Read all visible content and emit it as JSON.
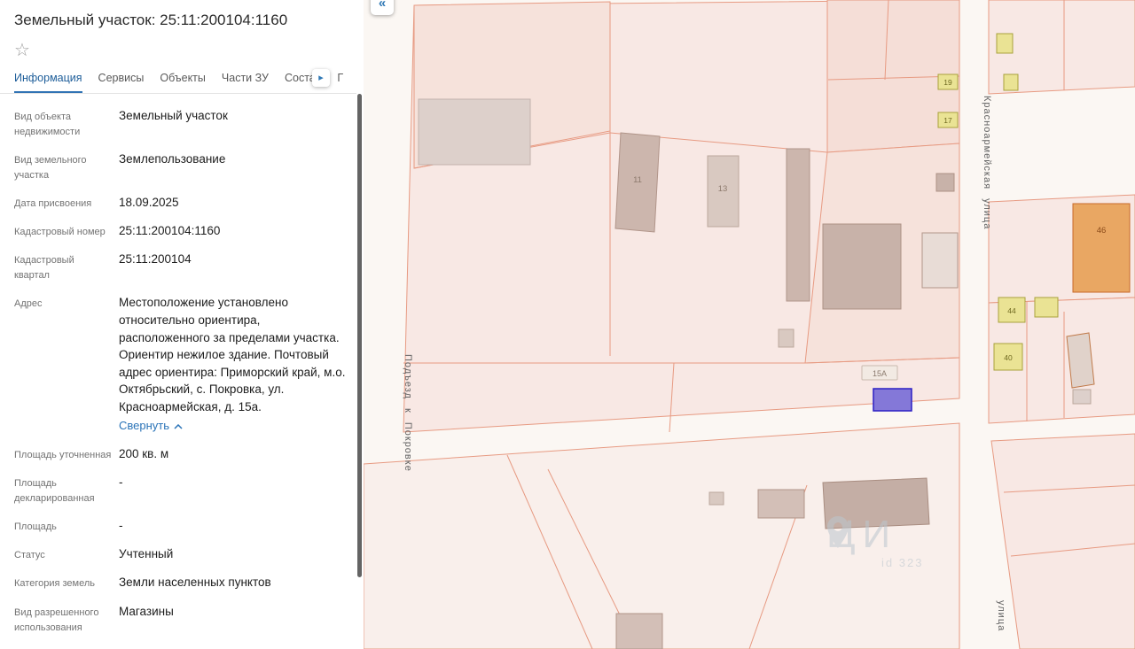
{
  "panel": {
    "title": "Земельный участок: 25:11:200104:1160",
    "favorite_icon": "star-outline",
    "tabs": [
      {
        "label": "Информация",
        "active": true
      },
      {
        "label": "Сервисы",
        "active": false
      },
      {
        "label": "Объекты",
        "active": false
      },
      {
        "label": "Части ЗУ",
        "active": false
      },
      {
        "label": "Состав",
        "active": false
      },
      {
        "label": "Г",
        "active": false
      }
    ],
    "tabs_more_icon": "▸",
    "fields": [
      {
        "label": "Вид объекта недвижимости",
        "value": "Земельный участок"
      },
      {
        "label": "Вид земельного участка",
        "value": "Землепользование"
      },
      {
        "label": "Дата присвоения",
        "value": "18.09.2025"
      },
      {
        "label": "Кадастровый номер",
        "value": "25:11:200104:1160"
      },
      {
        "label": "Кадастровый квартал",
        "value": "25:11:200104"
      },
      {
        "label": "Адрес",
        "value": "Местоположение установлено относительно ориентира, расположенного за пределами участка. Ориентир нежилое здание. Почтовый адрес ориентира: Приморский край, м.о. Октябрьский, с. Покровка, ул. Красноармейская, д. 15а."
      },
      {
        "label": "Площадь уточненная",
        "value": "200 кв. м"
      },
      {
        "label": "Площадь декларированная",
        "value": "-"
      },
      {
        "label": "Площадь",
        "value": "-"
      },
      {
        "label": "Статус",
        "value": "Учтенный"
      },
      {
        "label": "Категория земель",
        "value": "Земли населенных пунктов"
      },
      {
        "label": "Вид разрешенного использования",
        "value": "Магазины"
      }
    ],
    "address_collapse": "Свернуть"
  },
  "map": {
    "collapse_button": "«",
    "streets": {
      "s1": "Подъезд к Покровке",
      "s2": "Красноармейская улица",
      "s3": "улица"
    },
    "labels": {
      "b11": "11",
      "b13": "13",
      "b19": "19",
      "b17": "17",
      "b46": "46",
      "b44": "44",
      "b40": "40",
      "p15a": "15А"
    },
    "watermark": {
      "main": "ЦИ",
      "sub": "id 323"
    }
  },
  "colors": {
    "accent_blue": "#2f78b5",
    "tab_active": "#1d5d99",
    "parcel_fill": "#f8e8e4",
    "parcel_stroke": "#e79a82",
    "building_fill": "#ccb6ad",
    "yellow_building": "#eae394",
    "orange_building": "#e9a763",
    "selected_parcel_fill": "#8478d8",
    "selected_parcel_stroke": "#2b1fc4"
  }
}
